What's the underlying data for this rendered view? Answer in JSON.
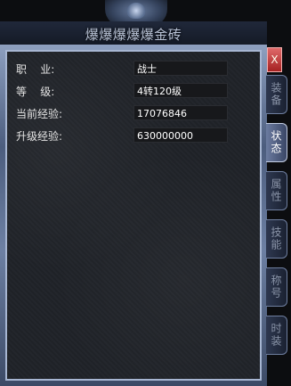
{
  "window": {
    "title": "爆爆爆爆爆金砖"
  },
  "close_label": "X",
  "stats": [
    {
      "label": "职    业:",
      "value": "战士"
    },
    {
      "label": "等    级:",
      "value": "4转120级"
    },
    {
      "label": "当前经验:",
      "value": "17076846"
    },
    {
      "label": "升级经验:",
      "value": "630000000"
    }
  ],
  "tabs": [
    {
      "label": "装备",
      "active": false
    },
    {
      "label": "状态",
      "active": true
    },
    {
      "label": "属性",
      "active": false
    },
    {
      "label": "技能",
      "active": false
    },
    {
      "label": "称号",
      "active": false
    },
    {
      "label": "时装",
      "active": false
    }
  ]
}
